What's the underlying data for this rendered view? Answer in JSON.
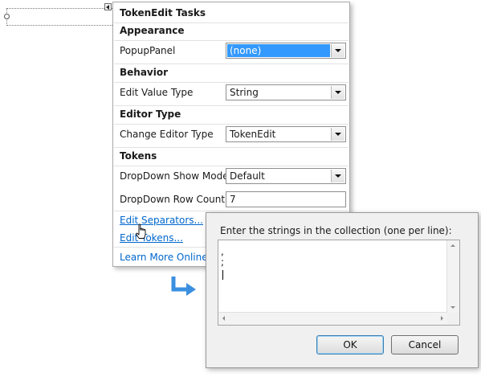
{
  "tasks_panel": {
    "title": "TokenEdit Tasks",
    "sections": {
      "appearance": "Appearance",
      "behavior": "Behavior",
      "editor_type": "Editor Type",
      "tokens": "Tokens"
    },
    "properties": {
      "popup_panel": {
        "label": "PopupPanel",
        "value": "(none)"
      },
      "edit_value_type": {
        "label": "Edit Value Type",
        "value": "String"
      },
      "change_editor_type": {
        "label": "Change Editor Type",
        "value": "TokenEdit"
      },
      "dropdown_show_mode": {
        "label": "DropDown Show Mode",
        "value": "Default"
      },
      "dropdown_row_count": {
        "label": "DropDown Row Count",
        "value": "7"
      }
    },
    "links": {
      "edit_separators": "Edit Separators...",
      "edit_tokens": "Edit Tokens...",
      "learn_more": "Learn More Online"
    }
  },
  "collection_dialog": {
    "prompt": "Enter the strings in the collection (one per line):",
    "lines": [
      ",",
      ";"
    ],
    "ok_label": "OK",
    "cancel_label": "Cancel"
  },
  "colors": {
    "accent": "#3399ff",
    "link": "#0066cc",
    "arrow": "#3b8fe0"
  }
}
